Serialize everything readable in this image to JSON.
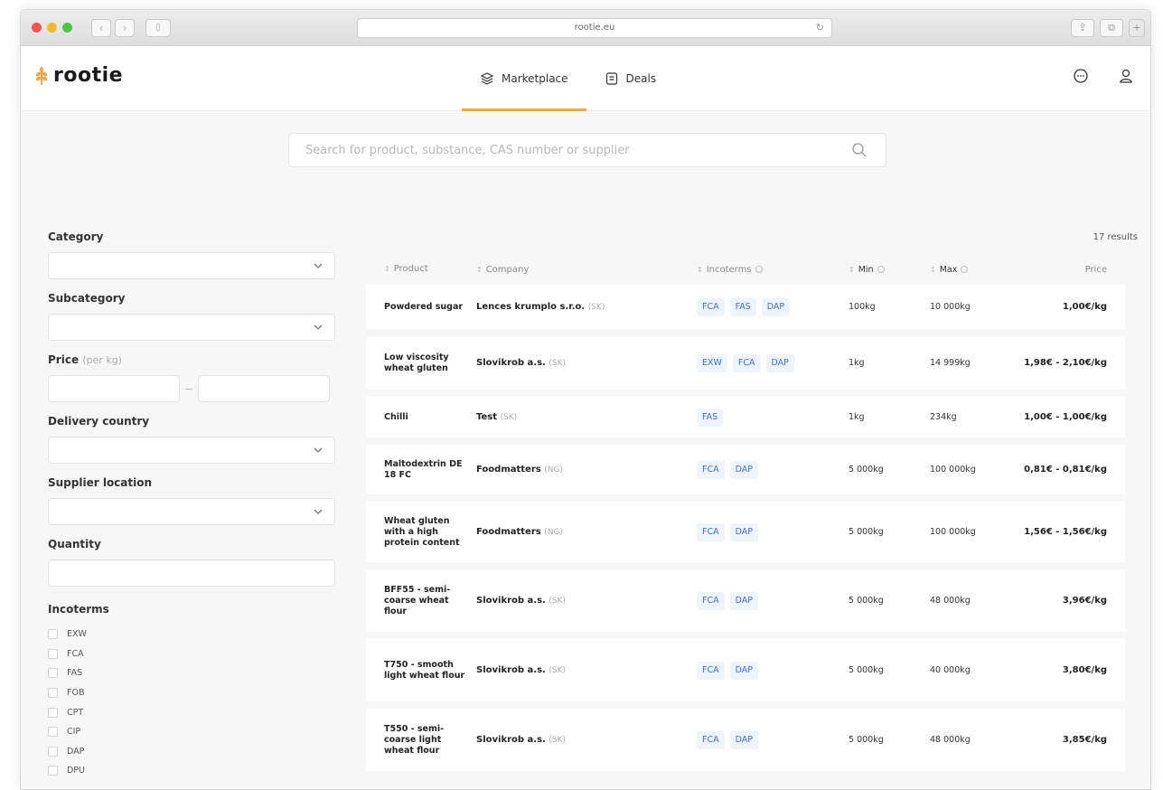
{
  "browser": {
    "url": "rootie.eu"
  },
  "app": {
    "logo_text": "rootie",
    "nav": [
      {
        "label": "Marketplace",
        "icon": "layers-icon",
        "active": true
      },
      {
        "label": "Deals",
        "icon": "document-icon",
        "active": false
      }
    ],
    "header_icons": [
      "chat-icon",
      "user-icon"
    ],
    "accent_color": "#f0a54a",
    "tag_color": "#3f6fd6"
  },
  "search": {
    "placeholder": "Search for product, substance, CAS number or supplier",
    "value": ""
  },
  "filters": {
    "category_label": "Category",
    "subcategory_label": "Subcategory",
    "price_label": "Price",
    "price_unit": "(per kg)",
    "delivery_country_label": "Delivery country",
    "supplier_location_label": "Supplier location",
    "quantity_label": "Quantity",
    "incoterms_label": "Incoterms",
    "incoterms": [
      "EXW",
      "FCA",
      "FAS",
      "FOB",
      "CPT",
      "CIP",
      "DAP",
      "DPU"
    ]
  },
  "results": {
    "count": "17 results",
    "columns": {
      "product": "Product",
      "company": "Company",
      "incoterms": "Incoterms",
      "min": "Min",
      "max": "Max",
      "price": "Price"
    },
    "rows": [
      {
        "product": "Powdered sugar",
        "company": "Lences krumplo s.r.o.",
        "country": "(SK)",
        "incoterms": [
          "FCA",
          "FAS",
          "DAP"
        ],
        "min": "100kg",
        "max": "10 000kg",
        "price": "1,00€/kg"
      },
      {
        "product": "Low viscosity wheat gluten",
        "company": "Slovikrob a.s.",
        "country": "(SK)",
        "incoterms": [
          "EXW",
          "FCA",
          "DAP"
        ],
        "min": "1kg",
        "max": "14 999kg",
        "price": "1,98€ - 2,10€/kg"
      },
      {
        "product": "Chilli",
        "company": "Test",
        "country": "(SK)",
        "incoterms": [
          "FAS"
        ],
        "min": "1kg",
        "max": "234kg",
        "price": "1,00€ - 1,00€/kg"
      },
      {
        "product": "Maltodextrin DE 18 FC",
        "company": "Foodmatters",
        "country": "(NG)",
        "incoterms": [
          "FCA",
          "DAP"
        ],
        "min": "5 000kg",
        "max": "100 000kg",
        "price": "0,81€ - 0,81€/kg"
      },
      {
        "product": "Wheat gluten with a high protein content",
        "company": "Foodmatters",
        "country": "(NG)",
        "incoterms": [
          "FCA",
          "DAP"
        ],
        "min": "5 000kg",
        "max": "100 000kg",
        "price": "1,56€ - 1,56€/kg"
      },
      {
        "product": "BFF55 - semi-coarse wheat flour",
        "company": "Slovikrob a.s.",
        "country": "(SK)",
        "incoterms": [
          "FCA",
          "DAP"
        ],
        "min": "5 000kg",
        "max": "48 000kg",
        "price": "3,96€/kg"
      },
      {
        "product": "T750 - smooth light wheat flour",
        "company": "Slovikrob a.s.",
        "country": "(SK)",
        "incoterms": [
          "FCA",
          "DAP"
        ],
        "min": "5 000kg",
        "max": "40 000kg",
        "price": "3,80€/kg"
      },
      {
        "product": "T550 - semi-coarse light wheat flour",
        "company": "Slovikrob a.s.",
        "country": "(SK)",
        "incoterms": [
          "FCA",
          "DAP"
        ],
        "min": "5 000kg",
        "max": "48 000kg",
        "price": "3,85€/kg"
      }
    ]
  }
}
